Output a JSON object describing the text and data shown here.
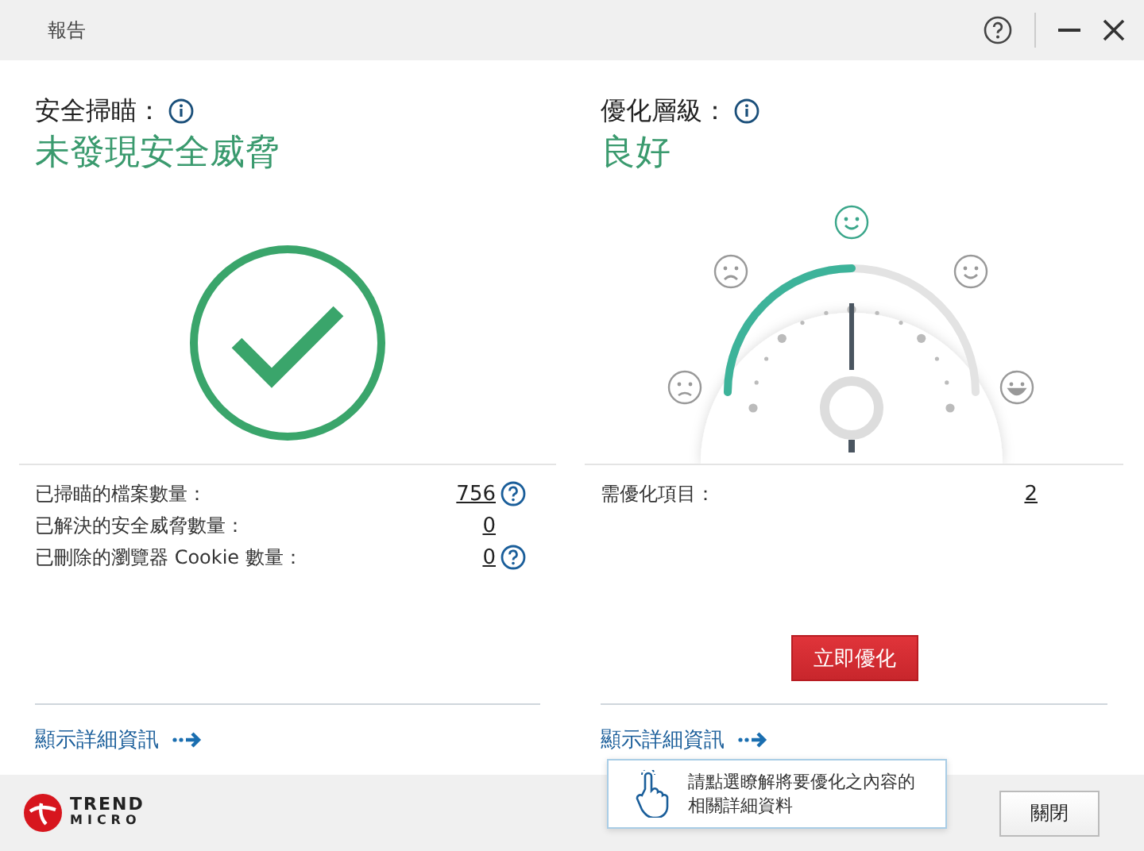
{
  "window": {
    "title": "報告"
  },
  "security_scan": {
    "heading": "安全掃瞄：",
    "status": "未發現安全威脅",
    "stats": [
      {
        "label": "已掃瞄的檔案數量：",
        "value": "756",
        "help": true
      },
      {
        "label": "已解決的安全威脅數量：",
        "value": "0",
        "help": false
      },
      {
        "label": "已刪除的瀏覽器 Cookie 數量：",
        "value": "0",
        "help": true
      }
    ],
    "details_link": "顯示詳細資訊"
  },
  "optimization": {
    "heading": "優化層級：",
    "status": "良好",
    "gauge": {
      "level": 0.5
    },
    "stats": [
      {
        "label": "需優化項目：",
        "value": "2",
        "help": false
      }
    ],
    "action_button": "立即優化",
    "details_link": "顯示詳細資訊",
    "tooltip": "請點選瞭解將要優化之內容的相關詳細資料"
  },
  "footer": {
    "logo": {
      "line1": "TREND",
      "line2": "MICRO"
    },
    "close_button": "關閉"
  }
}
